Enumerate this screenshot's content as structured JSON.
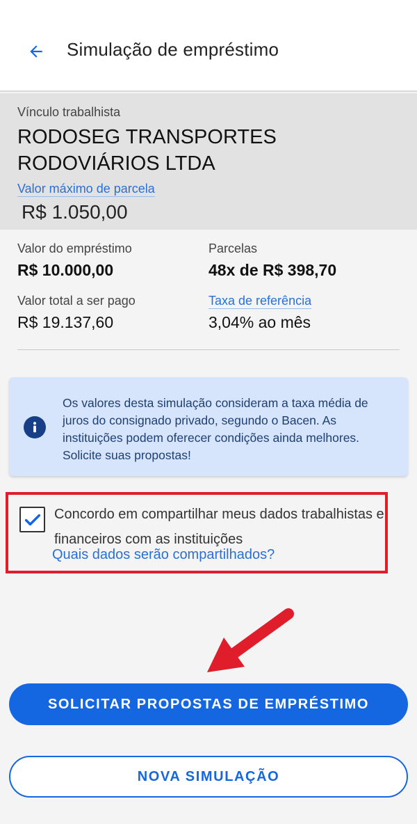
{
  "header": {
    "title": "Simulação de empréstimo",
    "back_icon": "arrow-left-icon",
    "accent": "#1467e0"
  },
  "employer": {
    "label": "Vínculo trabalhista",
    "name": "RODOSEG TRANSPORTES RODOVIÁRIOS LTDA",
    "max_installment_link": "Valor máximo de parcela",
    "max_installment_value": "R$ 1.050,00"
  },
  "summary": {
    "loan_amount_label": "Valor do empréstimo",
    "loan_amount_value": "R$ 10.000,00",
    "installments_label": "Parcelas",
    "installments_value": "48x de R$ 398,70",
    "total_label": "Valor total a ser pago",
    "total_value": "R$ 19.137,60",
    "rate_link": "Taxa de referência",
    "rate_value": "3,04% ao mês"
  },
  "info": {
    "icon": "info-icon",
    "text": "Os valores desta simulação consideram a taxa média de juros do consignado privado, segundo o Bacen. As instituições podem oferecer condições ainda melhores. Solicite suas propostas!"
  },
  "consent": {
    "checked": true,
    "text": "Concordo em compartilhar meus dados trabalhistas e financeiros com as instituições",
    "link": "Quais dados serão compartilhados?",
    "highlight_color": "#e01e2b"
  },
  "actions": {
    "primary_label": "SOLICITAR PROPOSTAS DE EMPRÉSTIMO",
    "secondary_label": "NOVA SIMULAÇÃO"
  }
}
